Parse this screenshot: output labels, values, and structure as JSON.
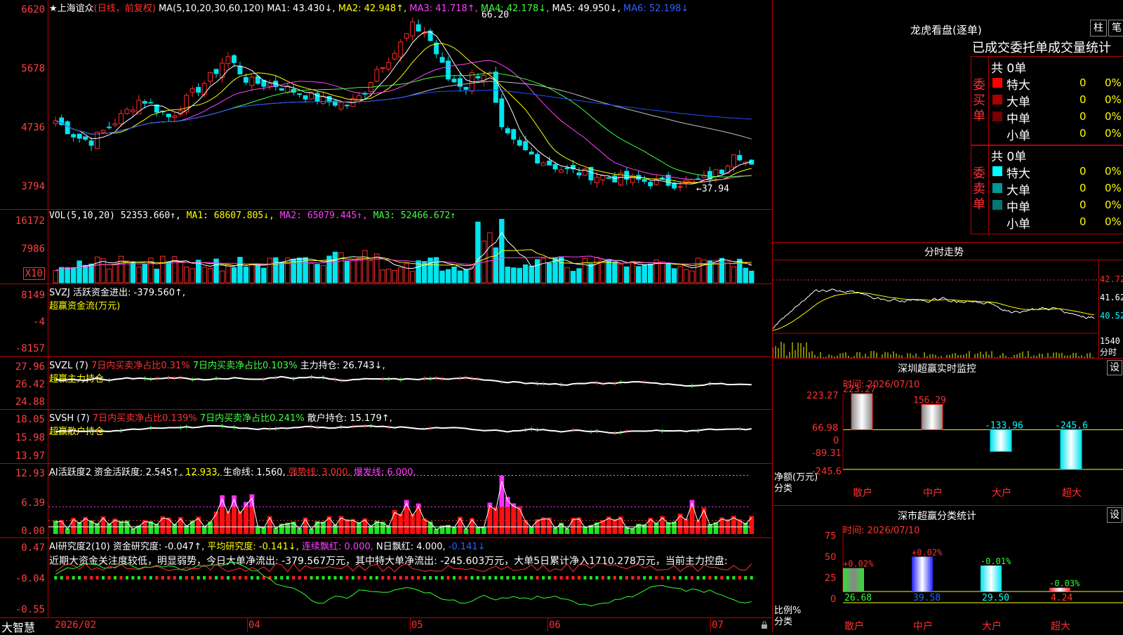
{
  "colors": {
    "up": "#ff2a2a",
    "down": "#00e5ee",
    "ma1": "#ffffff",
    "ma2": "#ffff00",
    "ma3": "#ff40ff",
    "ma4": "#40ff40",
    "ma5": "#c0c0c0",
    "ma6": "#2050ff"
  },
  "main": {
    "star_icon": "★",
    "stock_name": "上海谊众",
    "period": "(日线，前复权)",
    "ma_title": "MA(5,10,20,30,60,120)",
    "ma1": "MA1: 43.430↓,",
    "ma2": "MA2: 42.948↑,",
    "ma3": "MA3: 41.718↑,",
    "ma4": "MA4: 42.178↓,",
    "ma5": "MA5: 49.950↓,",
    "ma6": "MA6: 52.198↓",
    "y_labels": [
      "6620",
      "5678",
      "4736",
      "3794"
    ],
    "high_marker": "66.20",
    "low_marker": "←37.94"
  },
  "vol": {
    "title": "VOL(5,10,20)",
    "value": "52353.660↑,",
    "ma1": "MA1: 68607.805↓,",
    "ma2": "MA2: 65079.445↑,",
    "ma3": "MA3: 52466.672↑",
    "y_labels": [
      "16172",
      "7986"
    ],
    "unit": "X10"
  },
  "svzj": {
    "title": "SVZJ",
    "label": "活跃资金进出: -379.560↑,",
    "subtitle": "超赢资金流(万元)",
    "y_labels": [
      "8149",
      "-4",
      "-8157"
    ]
  },
  "svzl": {
    "title": "SVZL (7)",
    "a": "7日内买卖净占比0.31%",
    "b": "7日内买卖净占比0.103%",
    "c": "主力持仓: 26.743↓,",
    "subtitle": "超赢主力持仓",
    "y_labels": [
      "27.96",
      "26.42",
      "24.88"
    ]
  },
  "svsh": {
    "title": "SVSH (7)",
    "a": "7日内买卖净占比0.139%",
    "b": "7日内买卖净占比0.241%",
    "c": "散户持仓: 15.179↑,",
    "subtitle": "超赢散户持仓",
    "y_labels": [
      "18.05",
      "15.98",
      "13.97"
    ]
  },
  "ai1": {
    "title": "AI活跃度2",
    "a": "资金活跃度: 2.545↑,",
    "b": "12.933,",
    "c": "生命线: 1.560,",
    "d": "强势线: 3.000,",
    "e": "爆发线: 6.000,",
    "y_labels": [
      "12.93",
      "6.39",
      "0.00"
    ]
  },
  "ai2": {
    "title": "AI研究度2(10)",
    "a": "资金研究度: -0.047↑,",
    "b": "平均研究度: -0.141↓,",
    "c": "连续飘红: 0.000,",
    "d": "N日飘红: 4.000,",
    "e": "-0.141↓",
    "text": "近期大资金关注度较低，明显弱势，今日大单净流出: -379.567万元，其中特大单净流出: -245.603万元，大单5日累计净入1710.278万元，当前主力控盘:",
    "y_labels": [
      "0.47",
      "-0.04",
      "-0.55"
    ]
  },
  "xaxis": {
    "brand": "大智慧",
    "labels": [
      "2026/02",
      "04",
      "05",
      "06",
      "07"
    ]
  },
  "dragon": {
    "title": "龙虎看盘(逐单)",
    "btn1": "柱",
    "btn2": "笔",
    "subtitle": "已成交委托单成交量统计",
    "buy": {
      "side": "委买单",
      "total": "共 0单",
      "rows": [
        {
          "name": "特大",
          "val": "0",
          "pct": "0%",
          "color": "#ff0000"
        },
        {
          "name": "大单",
          "val": "0",
          "pct": "0%",
          "color": "#aa0000"
        },
        {
          "name": "中单",
          "val": "0",
          "pct": "0%",
          "color": "#770000"
        },
        {
          "name": "小单",
          "val": "0",
          "pct": "0%",
          "color": "#000000"
        }
      ]
    },
    "sell": {
      "side": "委卖单",
      "total": "共 0单",
      "rows": [
        {
          "name": "特大",
          "val": "0",
          "pct": "0%",
          "color": "#00ffff"
        },
        {
          "name": "大单",
          "val": "0",
          "pct": "0%",
          "color": "#009999"
        },
        {
          "name": "中单",
          "val": "0",
          "pct": "0%",
          "color": "#007777"
        },
        {
          "name": "小单",
          "val": "0",
          "pct": "0%",
          "color": "#000000"
        }
      ]
    }
  },
  "intraday": {
    "title": "分时走势",
    "y_labels": [
      "42.72",
      "41.62",
      "40.52"
    ],
    "vol_label": "1540",
    "vol_unit": "分时"
  },
  "monitor": {
    "title": "深圳超赢实时监控",
    "btn": "设",
    "time": "时间: 2026/07/10",
    "y_labels": [
      "223.27",
      "66.98",
      "0",
      "-89.31",
      "-245.6"
    ],
    "axis_name": "净额(万元)",
    "axis_cat": "分类"
  },
  "classify": {
    "title": "深市超赢分类统计",
    "btn": "设",
    "time": "时间: 2026/07/10",
    "y_labels": [
      "75",
      "50",
      "25",
      "0"
    ],
    "axis_name": "比例%",
    "axis_cat": "分类"
  },
  "chart_data": [
    {
      "type": "bar",
      "title": "深圳超赢实时监控",
      "categories": [
        "散户",
        "中户",
        "大户",
        "超大"
      ],
      "values": [
        223.27,
        156.29,
        -133.96,
        -245.6
      ],
      "data_labels": [
        "223.27",
        "156.29",
        "-133.96",
        "-245.6"
      ],
      "ylabel": "净额(万元)",
      "xlabel": "分类",
      "ylim": [
        -245.6,
        223.27
      ],
      "yticks": [
        223.27,
        66.98,
        0,
        -89.31,
        -245.6
      ]
    },
    {
      "type": "bar",
      "title": "深市超赢分类统计",
      "categories": [
        "散户",
        "中户",
        "大户",
        "超大"
      ],
      "values": [
        26.68,
        39.58,
        29.5,
        4.24
      ],
      "data_labels": [
        "26.68",
        "39.58",
        "29.50",
        "4.24"
      ],
      "change_labels": [
        "+0.02%",
        "+0.02%",
        "-0.01%",
        "-0.03%"
      ],
      "ylabel": "比例%",
      "xlabel": "分类",
      "ylim": [
        0,
        75
      ],
      "yticks": [
        75,
        50,
        25,
        0
      ]
    }
  ]
}
